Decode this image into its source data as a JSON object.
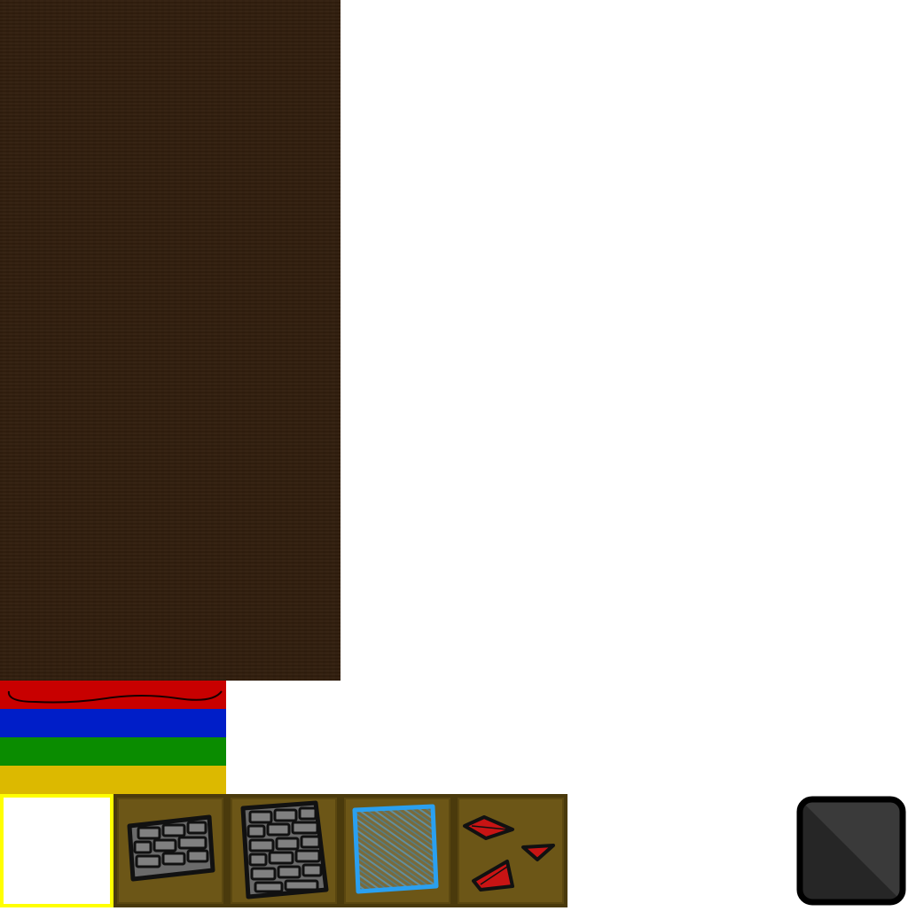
{
  "colors": {
    "dirt": "#33200f",
    "stripe_red": "#c80000",
    "stripe_blue": "#001ec8",
    "stripe_green": "#0a8c00",
    "stripe_yellow": "#dcb900",
    "slot_bg": "#6c5617",
    "slot_border": "#4a3a0c",
    "selected_border": "#ffff00",
    "stone_fill": "#6a6a6a",
    "glass_edge": "#2aa0f0",
    "ore_red": "#c81414",
    "dark_block": "#2a2a2a"
  },
  "stripes": [
    "red",
    "blue",
    "green",
    "yellow"
  ],
  "hotbar": {
    "selected_index": 0,
    "slots": [
      {
        "item": "empty"
      },
      {
        "item": "stone-brick-small",
        "icon": "stone-brick-icon"
      },
      {
        "item": "stone-brick-large",
        "icon": "stone-brick-icon"
      },
      {
        "item": "glass",
        "icon": "glass-block-icon"
      },
      {
        "item": "redstone-ore",
        "icon": "red-ore-icon"
      }
    ]
  },
  "side_block": {
    "item": "dark-stone",
    "icon": "dark-block-icon"
  }
}
